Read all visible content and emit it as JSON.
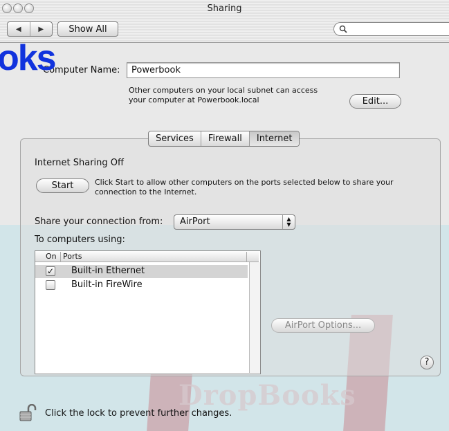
{
  "window": {
    "title": "Sharing",
    "show_all_label": "Show All",
    "search_placeholder": ""
  },
  "watermark": {
    "logo_fragment": "oks",
    "brand": "DropBooks"
  },
  "computer_name": {
    "label": "Computer Name:",
    "value": "Powerbook",
    "info_line1": "Other computers on your local subnet can access",
    "info_line2": "your computer at Powerbook.local",
    "edit_label": "Edit..."
  },
  "tabs": [
    {
      "label": "Services",
      "selected": false
    },
    {
      "label": "Firewall",
      "selected": false
    },
    {
      "label": "Internet",
      "selected": true
    }
  ],
  "internet": {
    "status": "Internet Sharing Off",
    "start_label": "Start",
    "start_info_line1": "Click Start to allow other computers on the ports selected below to share your",
    "start_info_line2": "connection to the Internet.",
    "share_from_label": "Share your connection from:",
    "share_from_value": "AirPort",
    "to_computers_label": "To computers using:",
    "columns": {
      "on": "On",
      "ports": "Ports"
    },
    "ports": [
      {
        "checked": true,
        "name": "Built-in Ethernet",
        "selected": true
      },
      {
        "checked": false,
        "name": "Built-in FireWire",
        "selected": false
      }
    ],
    "airport_options_label": "AirPort Options...",
    "help_label": "?"
  },
  "lock": {
    "text": "Click the lock to prevent further changes."
  }
}
